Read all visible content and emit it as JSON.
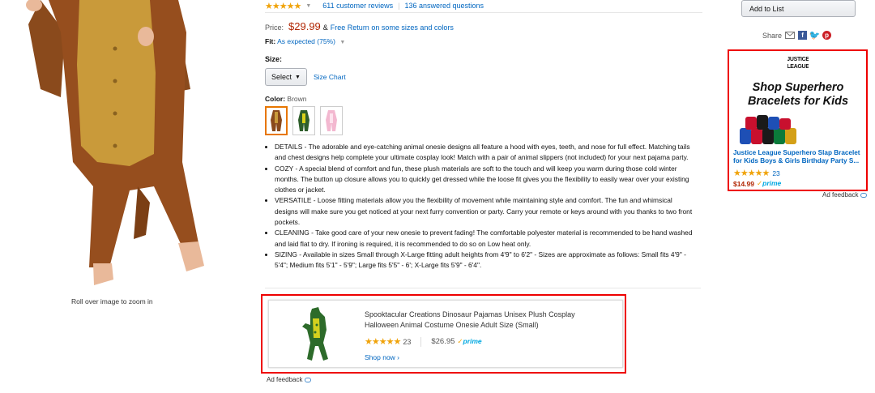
{
  "product": {
    "reviews_count": "611 customer reviews",
    "answered_questions": "136 answered questions",
    "rating_stars": "★★★★★",
    "price_label": "Price:",
    "price": "$29.99",
    "amp": "&",
    "free_return": "Free Return on some sizes and colors",
    "fit_label": "Fit:",
    "fit_value": "As expected (75%)",
    "size_label": "Size:",
    "size_select": "Select",
    "size_chart": "Size Chart",
    "color_label": "Color:",
    "color_value": "Brown",
    "zoom_hint": "Roll over image to zoom in",
    "bullets": [
      "DETAILS - The adorable and eye-catching animal onesie designs all feature a hood with eyes, teeth, and nose for full effect. Matching tails and chest designs help complete your ultimate cosplay look! Match with a pair of animal slippers (not included) for your next pajama party.",
      "COZY - A special blend of comfort and fun, these plush materials are soft to the touch and will keep you warm during those cold winter months. The button up closure allows you to quickly get dressed while the loose fit gives you the flexibility to easily wear over your existing clothes or jacket.",
      "VERSATILE - Loose fitting materials allow you the flexibility of movement while maintaining style and comfort. The fun and whimsical designs will make sure you get noticed at your next furry convention or party. Carry your remote or keys around with you thanks to two front pockets.",
      "CLEANING - Take good care of your new onesie to prevent fading! The comfortable polyester material is recommended to be hand washed and laid flat to dry. If ironing is required, it is recommended to do so on Low heat only.",
      "SIZING - Available in sizes Small through X-Large fitting adult heights from 4'9\" to 6'2\" - Sizes are approximate as follows: Small fits 4'9\" - 5'4\"; Medium fits 5'1\" - 5'9\"; Large fits 5'5\" - 6'; X-Large fits 5'9\" - 6'4\"."
    ]
  },
  "bottom_ad": {
    "title": "Spooktacular Creations Dinosaur Pajamas Unisex Plush Cosplay Halloween Animal Costume Onesie Adult Size (Small)",
    "stars": "★★★★★",
    "rating_count": "23",
    "price": "$26.95",
    "prime": "prime",
    "shop_now": "Shop now ›",
    "feedback": "Ad feedback"
  },
  "sidebar": {
    "add_to_list": "Add to List",
    "share_label": "Share",
    "ad": {
      "logo_text": "JUSTICE LEAGUE",
      "headline": "Shop Superhero Bracelets for Kids",
      "product_title_1": "Justice League Superhero Slap Bracelet",
      "product_title_2": "for Kids Boys & Girls Birthday Party S...",
      "stars": "★★★★★",
      "rating_count": "23",
      "price": "$14.99",
      "prime": "prime",
      "feedback": "Ad feedback"
    }
  },
  "colors": {
    "link": "#0066c0",
    "price": "#b12704",
    "star": "#f0a30a",
    "highlight_outline": "#ee0000"
  }
}
